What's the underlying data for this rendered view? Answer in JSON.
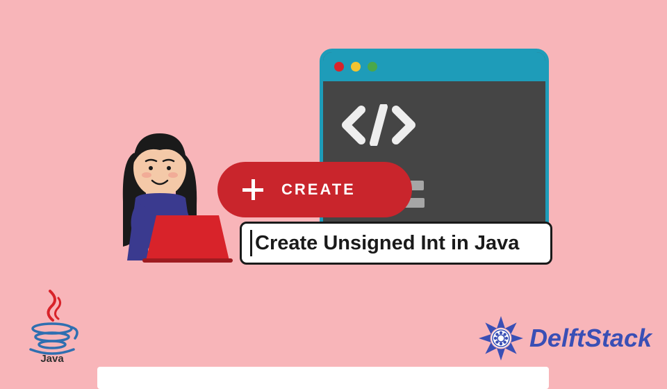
{
  "editor": {
    "dots": [
      "red",
      "yellow",
      "green"
    ],
    "code_icon": "code-tag-icon"
  },
  "create_pill": {
    "plus_icon": "plus-icon",
    "label": "CREATE"
  },
  "title_box": {
    "text": "Create Unsigned Int in Java"
  },
  "logos": {
    "java_label": "Java",
    "delftstack": "DelftStack"
  },
  "colors": {
    "bg": "#f8b5b9",
    "accent_red": "#c9252c",
    "accent_teal": "#1e9cb9",
    "editor_body": "#454545"
  }
}
